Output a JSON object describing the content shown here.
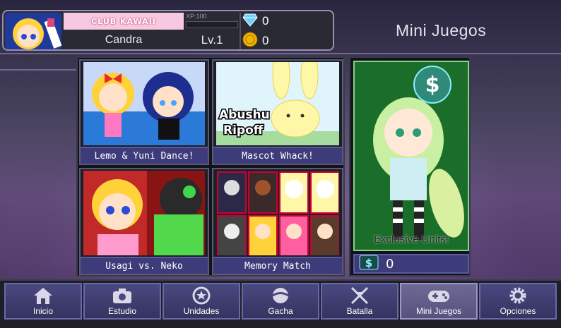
{
  "profile": {
    "banner_text": "CLUB KAWAII",
    "name": "Candra",
    "xp_label": "XP:100",
    "xp_progress": 0,
    "level": "Lv.1",
    "gems": "0",
    "coins": "0"
  },
  "page_title": "Mini Juegos",
  "games": [
    {
      "label": "Lemo & Yuni Dance!"
    },
    {
      "label": "Mascot Whack!",
      "art_text_1": "Abushu",
      "art_text_2": "Ripoff"
    },
    {
      "label": "Usagi vs. Neko"
    },
    {
      "label": "Memory Match"
    }
  ],
  "exclusive": {
    "art_text": "Exclusive Units!",
    "count": "0"
  },
  "nav": [
    {
      "label": "Inicio",
      "icon": "home-icon"
    },
    {
      "label": "Estudio",
      "icon": "camera-icon"
    },
    {
      "label": "Unidades",
      "icon": "star-icon"
    },
    {
      "label": "Gacha",
      "icon": "gacha-icon"
    },
    {
      "label": "Batalla",
      "icon": "swords-icon"
    },
    {
      "label": "Mini Juegos",
      "icon": "gamepad-icon",
      "active": true
    },
    {
      "label": "Opciones",
      "icon": "gear-icon"
    }
  ],
  "colors": {
    "accent": "#3d3b7a",
    "gem": "#6fd0ff",
    "coin": "#f0b400",
    "exclusive_bg": "#1a6e2a"
  }
}
